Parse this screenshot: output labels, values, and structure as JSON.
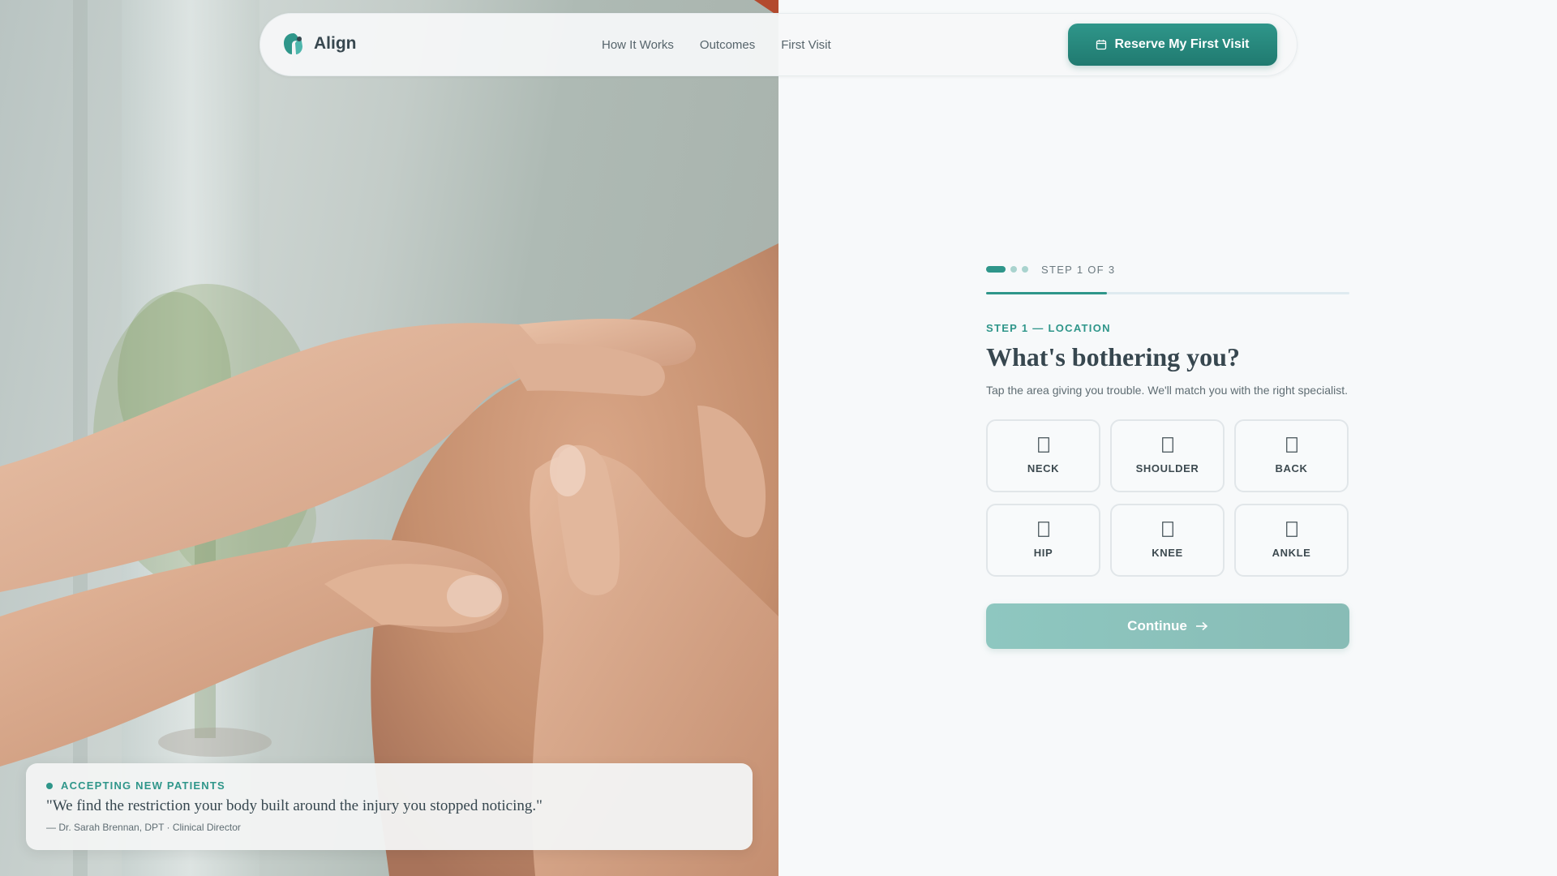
{
  "brand": {
    "name": "Align",
    "logo_icon": "align-logo-icon",
    "accent": "#2f968a"
  },
  "nav": {
    "links": [
      "How It Works",
      "Outcomes",
      "First Visit"
    ],
    "cta_label": "Reserve My First Visit",
    "cta_icon": "calendar-icon"
  },
  "photo": {
    "subject": "hands-on-knee-photo"
  },
  "step": {
    "current": 1,
    "total": 3,
    "counter": "STEP 1 OF 3",
    "progress_fraction": 0.333,
    "eyebrow": "STEP 1 — LOCATION",
    "title": "What's bothering you?",
    "subtitle": "Tap the area giving you trouble. We'll match you with the right specialist."
  },
  "areas": [
    {
      "label": "NECK",
      "icon": "placeholder-glyph-icon"
    },
    {
      "label": "SHOULDER",
      "icon": "placeholder-glyph-icon"
    },
    {
      "label": "BACK",
      "icon": "placeholder-glyph-icon"
    },
    {
      "label": "HIP",
      "icon": "placeholder-glyph-icon"
    },
    {
      "label": "KNEE",
      "icon": "placeholder-glyph-icon"
    },
    {
      "label": "ANKLE",
      "icon": "placeholder-glyph-icon"
    }
  ],
  "continue": {
    "label": "Continue",
    "icon": "arrow-right-icon"
  },
  "testimonial": {
    "badge": "ACCEPTING NEW PATIENTS",
    "quote": "\"We find the restriction your body built around the injury you stopped noticing.\"",
    "attribution": "— Dr. Sarah Brennan, DPT · Clinical Director"
  }
}
